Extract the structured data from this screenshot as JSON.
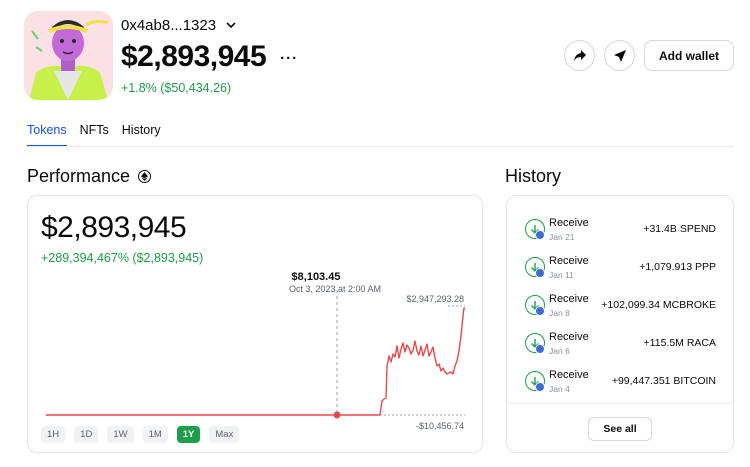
{
  "header": {
    "address": "0x4ab8...1323",
    "balance": "$2,893,945",
    "more": "···",
    "change": "+1.8% ($50,434.26)",
    "add_wallet_label": "Add wallet"
  },
  "tabs": [
    {
      "label": "Tokens",
      "active": true
    },
    {
      "label": "NFTs",
      "active": false
    },
    {
      "label": "History",
      "active": false
    }
  ],
  "performance": {
    "title": "Performance",
    "value": "$2,893,945",
    "change": "+289,394,467% ($2,893,945)",
    "tooltip_value": "$8,103.45",
    "tooltip_date": "Oct 3, 2023 at 2:00 AM",
    "max_label": "$2,947,293.28",
    "min_label": "-$10,456.74",
    "ranges": [
      {
        "label": "1H",
        "active": false
      },
      {
        "label": "1D",
        "active": false
      },
      {
        "label": "1W",
        "active": false
      },
      {
        "label": "1M",
        "active": false
      },
      {
        "label": "1Y",
        "active": true
      },
      {
        "label": "Max",
        "active": false
      }
    ]
  },
  "history": {
    "title": "History",
    "see_all_label": "See all",
    "items": [
      {
        "label": "Receive",
        "date": "Jan 21",
        "amount": "+31.4B SPEND"
      },
      {
        "label": "Receive",
        "date": "Jan 11",
        "amount": "+1,079.913 PPP"
      },
      {
        "label": "Receive",
        "date": "Jan 8",
        "amount": "+102,099.34 MCBROKE"
      },
      {
        "label": "Receive",
        "date": "Jan 6",
        "amount": "+115.5M RACA"
      },
      {
        "label": "Receive",
        "date": "Jan 4",
        "amount": "+99,447.351 BITCOIN"
      }
    ]
  },
  "colors": {
    "accent": "#1652f0",
    "positive": "#1d9e4a",
    "chart_line": "#e8484c"
  }
}
